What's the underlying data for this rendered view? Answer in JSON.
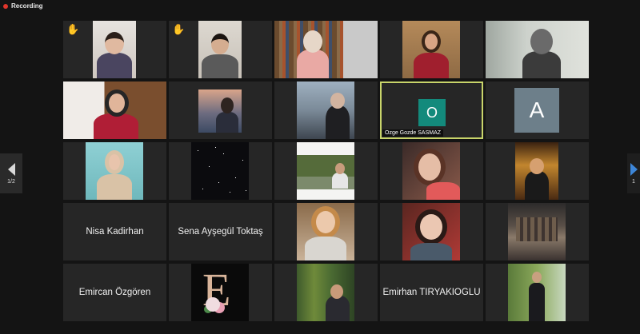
{
  "recording": {
    "label": "Recording",
    "color": "#e0352b"
  },
  "pagination": {
    "left_label": "1/2",
    "right_label": "1"
  },
  "raised_hand_icon": "raised-hand-icon",
  "active_speaker_color": "#c8d46a",
  "tiles": {
    "r3c4": {
      "initial": "O",
      "name": "Ozge Gozde SASMAZ",
      "avatar_color": "#138a7c"
    },
    "r3c5": {
      "initial": "A",
      "avatar_color": "#6d7f8a"
    },
    "r4c1": {
      "name": "Nisa Kadirhan"
    },
    "r4c2": {
      "name": "Sena Ayşegül Toktaş"
    },
    "r5c1": {
      "name": "Emircan Özgören"
    },
    "r5c2": {
      "letter": "E"
    },
    "r5c4": {
      "name": "Emirhan TIRYAKIOGLU"
    }
  }
}
